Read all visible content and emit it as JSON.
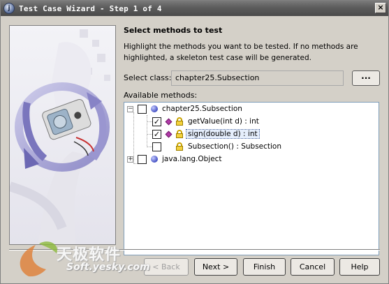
{
  "window": {
    "title": "Test Case Wizard - Step 1 of 4",
    "app_icon_glyph": "j",
    "close_glyph": "×"
  },
  "main": {
    "heading": "Select methods to test",
    "description": "Highlight the methods you want to be tested.  If no methods are highlighted, a skeleton test case will be generated.",
    "select_class_label": "Select class:",
    "select_class_value": "chapter25.Subsection",
    "browse_label": "...",
    "available_methods_label": "Available methods:"
  },
  "tree": {
    "nodes": [
      {
        "label": "chapter25.Subsection",
        "checked": false,
        "expanded": true,
        "kind": "class-icon"
      },
      {
        "label": "getValue(int d) : int",
        "checked": true,
        "kind": "method-icon"
      },
      {
        "label": "sign(double d) : int",
        "checked": true,
        "selected": true,
        "kind": "method-icon"
      },
      {
        "label": "Subsection() : Subsection",
        "checked": false,
        "kind": "method-icon"
      },
      {
        "label": "java.lang.Object",
        "checked": false,
        "expanded": false,
        "kind": "class-icon"
      }
    ],
    "collapse_glyph": "−",
    "expand_glyph": "+",
    "check_glyph": "✓"
  },
  "buttons": {
    "back": "< Back",
    "next": "Next >",
    "finish": "Finish",
    "cancel": "Cancel",
    "help": "Help"
  },
  "watermark": {
    "cn": "天极软件",
    "en": "Soft.yesky.com"
  }
}
